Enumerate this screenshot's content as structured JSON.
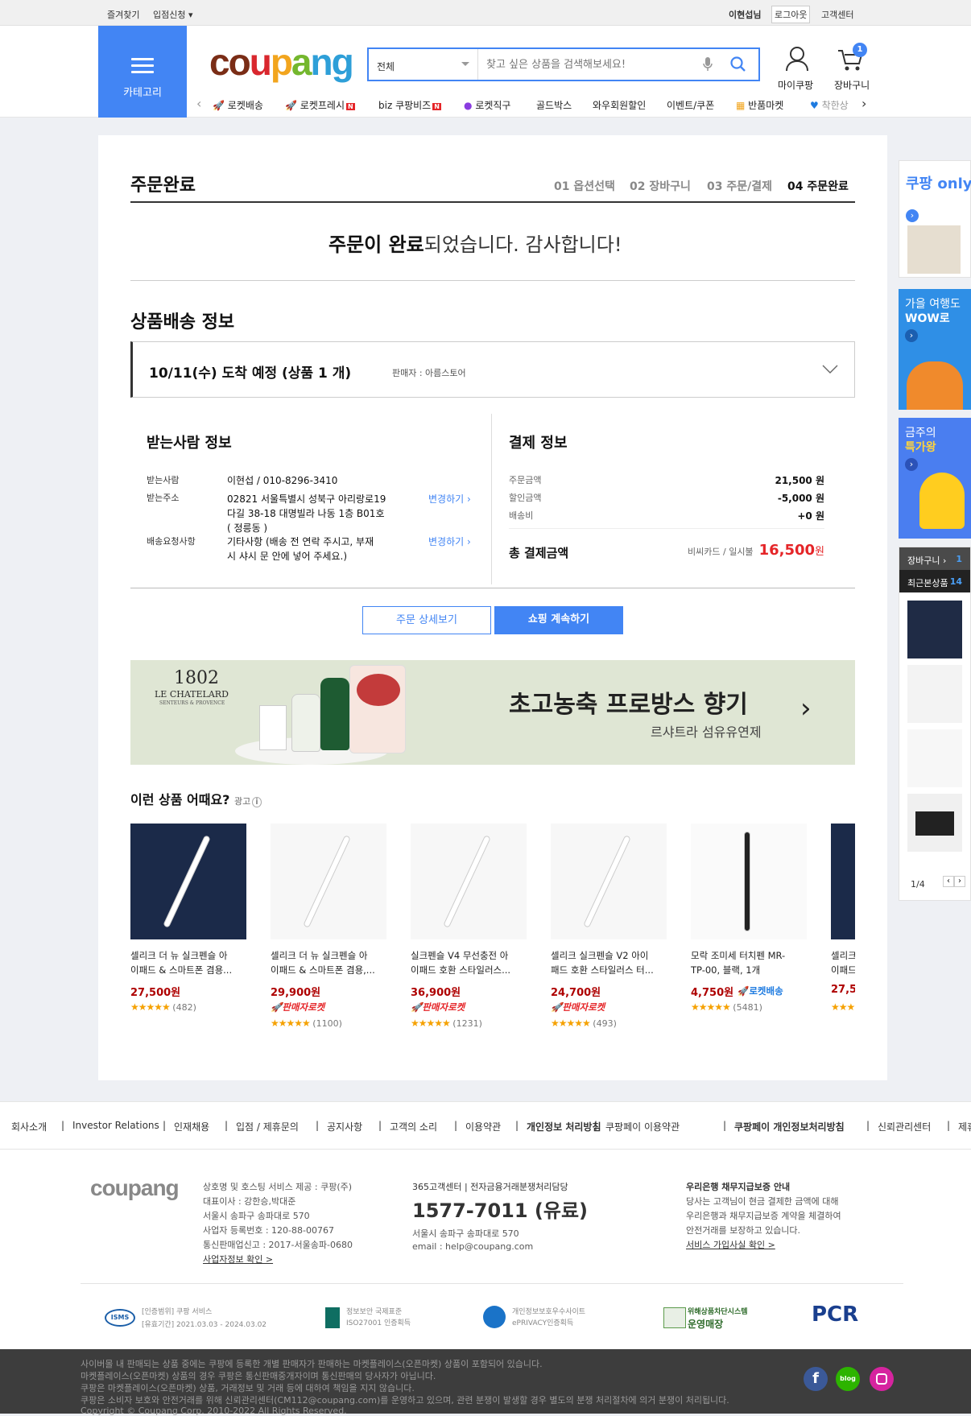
{
  "util": {
    "bookmark": "즐겨찾기",
    "seller": "입점신청",
    "user": "이현섭님",
    "logout": "로그아웃",
    "cs": "고객센터"
  },
  "header": {
    "category": "카테고리",
    "logo": "coupang",
    "search_cat": "전체",
    "search_placeholder": "찾고 싶은 상품을 검색해보세요!",
    "mycoupang": "마이쿠팡",
    "cart": "장바구니",
    "cart_count": "1"
  },
  "nav": [
    "로켓배송",
    "로켓프레시",
    "biz 쿠팡비즈",
    "로켓직구",
    "골드박스",
    "와우회원할인",
    "이벤트/쿠폰",
    "반품마켓",
    "착한상"
  ],
  "order": {
    "title": "주문완료",
    "steps": [
      "01 옵션선택",
      "02 장바구니",
      "03 주문/결제",
      "04 주문완료"
    ],
    "msg_bold": "주문이 완료",
    "msg_rest": "되었습니다. 감사합니다!",
    "ship_title": "상품배송 정보",
    "ship_date": "10/11(수) 도착 예정 (상품 1 개)",
    "seller": "판매자 : 아름스토어",
    "recv_title": "받는사람 정보",
    "recv_name_label": "받는사람",
    "recv_name": "이현섭 / 010-8296-3410",
    "recv_addr_label": "받는주소",
    "recv_addr1": "02821 서울특별시 성북구 아리랑로19",
    "recv_addr2": "다길 38-18 대명빌라 나동 1층 B01호",
    "recv_addr3": "( 정릉동 )",
    "recv_req_label": "배송요청사항",
    "recv_req1": "기타사항 (배송 전 연락 주시고, 부재",
    "recv_req2": "시 샤시 문 안에 넣어 주세요.)",
    "change": "변경하기",
    "pay_title": "결제 정보",
    "pay_order_label": "주문금액",
    "pay_order": "21,500 원",
    "pay_disc_label": "할인금액",
    "pay_disc": "-5,000 원",
    "pay_ship_label": "배송비",
    "pay_ship": "+0 원",
    "pay_total_label": "총 결제금액",
    "pay_method": "비씨카드 / 일시불",
    "pay_total": "16,500",
    "won": "원",
    "detail_btn": "주문 상세보기",
    "continue_btn": "쇼핑 계속하기"
  },
  "banner": {
    "brand": "1802",
    "brand2": "LE CHATELARD",
    "brand3": "SENTEURS & PROVENCE",
    "headline": "초고농축 프로방스 향기",
    "sub": "르샤트라 섬유유연제"
  },
  "reco": {
    "title": "이런 상품 어때요?",
    "ad": "광고",
    "items": [
      {
        "name1": "셀리크 더 뉴 실크펜슬 아",
        "name2": "이패드 & 스마트폰 겸용...",
        "price": "27,500원",
        "badge": "",
        "rating": "(482)"
      },
      {
        "name1": "셀리크 더 뉴 실크펜슬 아",
        "name2": "이패드 & 스마트폰 겸용,...",
        "price": "29,900원",
        "badge": "판매자로켓",
        "rating": "(1100)"
      },
      {
        "name1": "실크펜슬 V4 무선충전 아",
        "name2": "이패드 호환 스타일러스...",
        "price": "36,900원",
        "badge": "판매자로켓",
        "rating": "(1231)"
      },
      {
        "name1": "셀리크 실크펜슬 V2 아이",
        "name2": "패드 호환 스타일러스 터...",
        "price": "24,700원",
        "badge": "판매자로켓",
        "rating": "(493)"
      },
      {
        "name1": "모락 조미세 터치펜 MR-",
        "name2": "TP-00, 블랙, 1개",
        "price": "4,750원",
        "badge": "로켓배송",
        "rating": "(5481)"
      },
      {
        "name1": "셀리크",
        "name2": "이패드",
        "price": "27,5",
        "badge": "",
        "rating": ""
      }
    ]
  },
  "rail": {
    "only": "쿠팡 only",
    "travel1": "가을 여행도",
    "travel2": "WOW로",
    "week1": "금주의",
    "week2": "특가왕",
    "cart": "장바구니",
    "cart_n": "1",
    "recent": "최근본상품",
    "recent_n": "14",
    "page": "1/4"
  },
  "footer_links": [
    "회사소개",
    "Investor Relations",
    "인재채용",
    "입점 / 제휴문의",
    "공지사항",
    "고객의 소리",
    "이용약관",
    "개인정보 처리방침",
    "쿠팡페이 이용약관",
    "쿠팡페이 개인정보처리방침",
    "신뢰관리센터",
    "제휴"
  ],
  "footer": {
    "logo": "coupang",
    "c1": "상호명 및 호스팅 서비스 제공 : 쿠팡(주)",
    "c2": "대표이사 : 강한승,박대준",
    "c3": "서울시 송파구 송파대로 570",
    "c4": "사업자 등록번호 : 120-88-00767",
    "c5": "통신판매업신고 : 2017-서울송파-0680",
    "c6": "사업자정보 확인 >",
    "cs_title": "365고객센터 | 전자금융거래분쟁처리담당",
    "cs_phone": "1577-7011 (유료)",
    "cs_addr": "서울시 송파구 송파대로 570",
    "cs_email": "email : help@coupang.com",
    "bank_title": "우리은행 채무지급보증 안내",
    "bank1": "당사는 고객님이 현금 결제한 금액에 대해",
    "bank2": "우리은행과 채무지급보증 계약을 체결하여",
    "bank3": "안전거래를 보장하고 있습니다.",
    "bank4": "서비스 가입사실 확인 >",
    "cert1a": "[인증범위] 쿠팡 서비스",
    "cert1b": "[유효기간] 2021.03.03 - 2024.03.02",
    "cert2a": "정보보안 국제표준",
    "cert2b": "ISO27001 인증획득",
    "cert3a": "개인정보보호우수사이트",
    "cert3b": "ePRIVACY인증획득",
    "cert4a": "위해상품차단시스템",
    "cert4b": "운영매장",
    "cert5": "PCR"
  },
  "bottom": [
    "사이버몰 내 판매되는 상품 중에는 쿠팡에 등록한 개별 판매자가 판매하는 마켓플레이스(오픈마켓) 상품이 포함되어 있습니다.",
    "마켓플레이스(오픈마켓) 상품의 경우 쿠팡은 통신판매중개자이며 통신판매의 당사자가 아닙니다.",
    "쿠팡은 마켓플레이스(오픈마켓) 상품, 거래정보 및 거래 등에 대하여 책임을 지지 않습니다.",
    "쿠팡은 소비자 보호와 안전거래를 위해 신뢰관리센터(CM112@coupang.com)를 운영하고 있으며, 관련 분쟁이 발생할 경우 별도의 분쟁 처리절차에 의거 분쟁이 처리됩니다.",
    "Copyright © Coupang Corp. 2010-2022 All Rights Reserved."
  ],
  "colors": {
    "primary": "#4285f4",
    "price_red": "#ae0000",
    "total_red": "#e52528"
  }
}
